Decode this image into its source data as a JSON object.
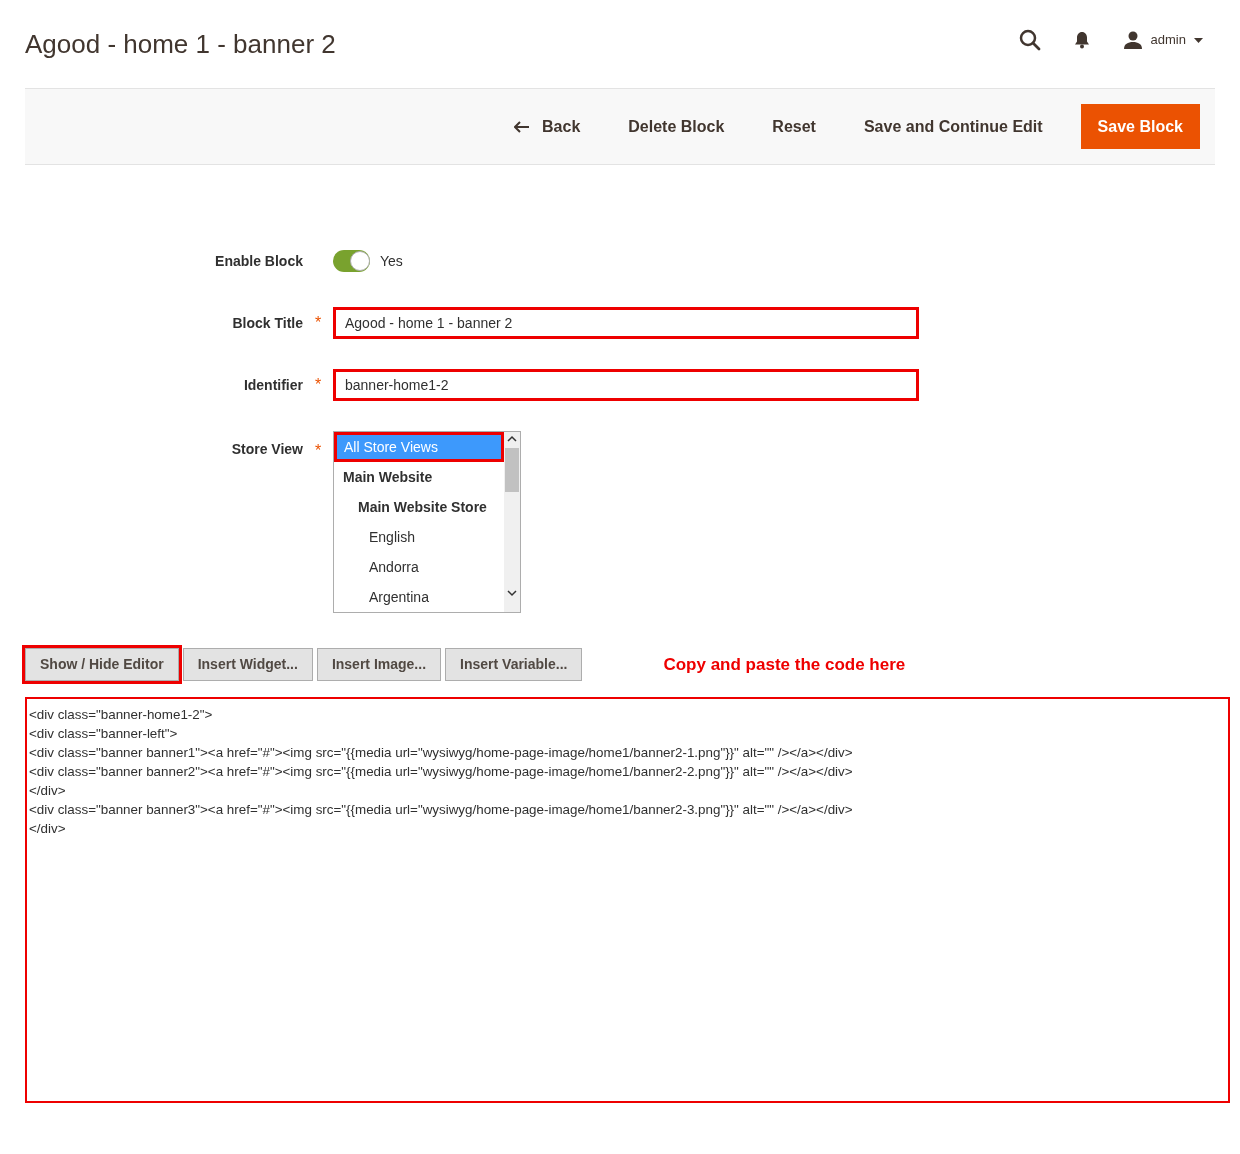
{
  "header": {
    "title": "Agood - home 1 - banner 2",
    "user": "admin"
  },
  "actions": [
    {
      "label": "Back",
      "kind": "back"
    },
    {
      "label": "Delete Block",
      "kind": "plain"
    },
    {
      "label": "Reset",
      "kind": "plain"
    },
    {
      "label": "Save and Continue Edit",
      "kind": "plain"
    },
    {
      "label": "Save Block",
      "kind": "primary"
    }
  ],
  "form": {
    "enable": {
      "label": "Enable Block",
      "on": true,
      "value": "Yes"
    },
    "block_title": {
      "label": "Block Title",
      "value": "Agood - home 1 - banner 2",
      "required_mark": "*",
      "highlighted": true
    },
    "identifier": {
      "label": "Identifier",
      "value": "banner-home1-2",
      "required_mark": "*",
      "highlighted": true
    },
    "store_view": {
      "label": "Store View",
      "required_mark": "*",
      "options": [
        {
          "label": "All Store Views",
          "selected": true,
          "highlighted": true
        },
        {
          "label": "Main Website",
          "selected": false,
          "children": [
            {
              "label": "Main Website Store",
              "selected": false,
              "children": [
                {
                  "label": "English",
                  "selected": false
                },
                {
                  "label": "Andorra",
                  "selected": false
                },
                {
                  "label": "Argentina",
                  "selected": false
                }
              ]
            }
          ]
        }
      ]
    }
  },
  "editor_buttons": [
    {
      "label": "Show / Hide Editor",
      "highlighted": true
    },
    {
      "label": "Insert Widget...",
      "highlighted": false
    },
    {
      "label": "Insert Image...",
      "highlighted": false
    },
    {
      "label": "Insert Variable...",
      "highlighted": false
    }
  ],
  "annotation": "Copy and paste the code here",
  "content_lines": [
    "<div class=\"banner-home1-2\">",
    "<div class=\"banner-left\">",
    "<div class=\"banner banner1\"><a href=\"#\"><img src=\"{{media url=\"wysiwyg/home-page-image/home1/banner2-1.png\"}}\" alt=\"\" /></a></div>",
    "<div class=\"banner banner2\"><a href=\"#\"><img src=\"{{media url=\"wysiwyg/home-page-image/home1/banner2-2.png\"}}\" alt=\"\" /></a></div>",
    "</div>",
    "<div class=\"banner banner3\"><a href=\"#\"><img src=\"{{media url=\"wysiwyg/home-page-image/home1/banner2-3.png\"}}\" alt=\"\" /></a></div>",
    "</div>"
  ]
}
